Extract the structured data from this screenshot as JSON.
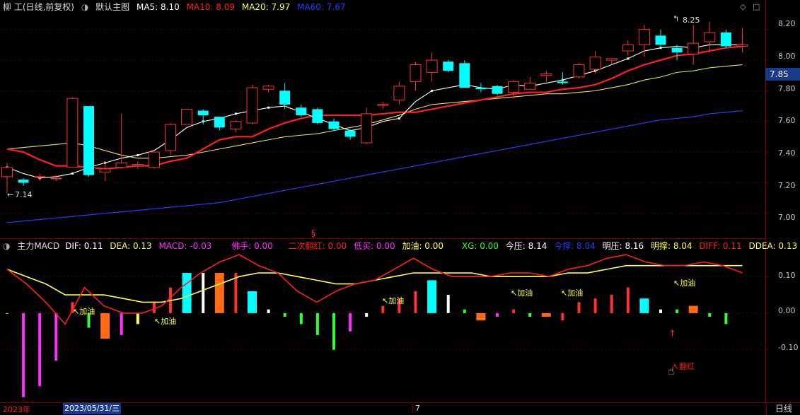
{
  "main": {
    "stock": "柳 工(日线,前复权)",
    "template": "默认主图",
    "ma": [
      {
        "label": "MA5: 8.10",
        "color": "#ffffff"
      },
      {
        "label": "MA10: 8.09",
        "color": "#ff2020"
      },
      {
        "label": "MA20: 7.97",
        "color": "#ffff50"
      },
      {
        "label": "MA60: 7.67",
        "color": "#2a3cff"
      }
    ],
    "y_ticks": [
      "8.20",
      "8.00",
      "7.80",
      "7.60",
      "7.40",
      "7.20",
      "7.00"
    ],
    "current_price": "7.85",
    "low_label": "7.14",
    "high_label": "8.25",
    "marker": "§"
  },
  "sub": {
    "indicator": "主力MACD",
    "values": [
      {
        "label": "DIF: 0.11",
        "color": "#ffffff"
      },
      {
        "label": "DEA: 0.13",
        "color": "#ffff50"
      },
      {
        "label": "MACD: -0.03",
        "color": "#ff30ff"
      },
      {
        "label": "佛手: 0.00",
        "color": "#ff30ff"
      },
      {
        "label": "二次翻红: 0.00",
        "color": "#ff2020"
      },
      {
        "label": "低买: 0.00",
        "color": "#ff30ff"
      },
      {
        "label": "加油: 0.00",
        "color": "#ffff50"
      },
      {
        "label": "XG: 0.00",
        "color": "#30ff30"
      },
      {
        "label": "今压: 8.14",
        "color": "#ffffff"
      },
      {
        "label": "今撑: 8.04",
        "color": "#2a3cff"
      },
      {
        "label": "明压: 8.16",
        "color": "#ffffff"
      },
      {
        "label": "明撑: 8.04",
        "color": "#ffff50"
      },
      {
        "label": "DIFF: 0.11",
        "color": "#ff2020"
      },
      {
        "label": "DDEA: 0.13",
        "color": "#ffff50"
      }
    ],
    "y_ticks": [
      "0.10",
      "0.00",
      "-0.10"
    ],
    "jiayou": "加油",
    "fanhong": "翻红"
  },
  "footer": {
    "year": "2023年",
    "date": "2023/05/31/三",
    "month": "7",
    "period": "日线"
  },
  "colors": {
    "up": "#ff3232",
    "down": "#00ffff",
    "bg": "#000000",
    "grid": "#7a0000"
  },
  "chart_data": {
    "type": "candlestick",
    "candles": [
      [
        7.24,
        7.3,
        7.33,
        7.13
      ],
      [
        7.22,
        7.2,
        7.23,
        7.18
      ],
      [
        7.24,
        7.24,
        7.26,
        7.21
      ],
      [
        7.23,
        7.23,
        7.25,
        7.21
      ],
      [
        7.3,
        7.75,
        7.76,
        7.3
      ],
      [
        7.7,
        7.25,
        7.7,
        7.24
      ],
      [
        7.27,
        7.29,
        7.34,
        7.21
      ],
      [
        7.3,
        7.33,
        7.65,
        7.29
      ],
      [
        7.31,
        7.32,
        7.34,
        7.29
      ],
      [
        7.3,
        7.4,
        7.41,
        7.29
      ],
      [
        7.41,
        7.58,
        7.59,
        7.38
      ],
      [
        7.58,
        7.68,
        7.68,
        7.58
      ],
      [
        7.67,
        7.64,
        7.68,
        7.58
      ],
      [
        7.63,
        7.56,
        7.63,
        7.54
      ],
      [
        7.55,
        7.6,
        7.61,
        7.53
      ],
      [
        7.59,
        7.82,
        7.84,
        7.58
      ],
      [
        7.81,
        7.83,
        7.84,
        7.79
      ],
      [
        7.8,
        7.71,
        7.85,
        7.68
      ],
      [
        7.69,
        7.64,
        7.71,
        7.63
      ],
      [
        7.68,
        7.59,
        7.69,
        7.58
      ],
      [
        7.6,
        7.55,
        7.62,
        7.54
      ],
      [
        7.54,
        7.5,
        7.55,
        7.48
      ],
      [
        7.46,
        7.65,
        7.69,
        7.45
      ],
      [
        7.71,
        7.71,
        7.73,
        7.68
      ],
      [
        7.74,
        7.83,
        7.86,
        7.71
      ],
      [
        7.86,
        7.97,
        7.99,
        7.8
      ],
      [
        7.92,
        8.0,
        8.05,
        7.86
      ],
      [
        7.99,
        7.93,
        8.0,
        7.92
      ],
      [
        7.98,
        7.82,
        8.0,
        7.82
      ],
      [
        7.82,
        7.81,
        7.85,
        7.79
      ],
      [
        7.83,
        7.78,
        7.84,
        7.77
      ],
      [
        7.79,
        7.86,
        7.87,
        7.75
      ],
      [
        7.81,
        7.85,
        7.89,
        7.81
      ],
      [
        7.9,
        7.91,
        7.93,
        7.86
      ],
      [
        7.86,
        7.85,
        7.92,
        7.84
      ],
      [
        7.89,
        7.97,
        7.98,
        7.88
      ],
      [
        7.94,
        8.02,
        8.06,
        7.91
      ],
      [
        8.0,
        8.01,
        8.01,
        7.97
      ],
      [
        8.06,
        8.1,
        8.13,
        8.03
      ],
      [
        8.1,
        8.2,
        8.23,
        8.02
      ],
      [
        8.16,
        8.1,
        8.2,
        8.08
      ],
      [
        8.08,
        8.05,
        8.1,
        8.0
      ],
      [
        8.04,
        8.11,
        8.23,
        7.97
      ],
      [
        8.12,
        8.18,
        8.25,
        8.05
      ],
      [
        8.18,
        8.09,
        8.2,
        8.08
      ],
      [
        8.09,
        8.1,
        8.21,
        8.05
      ]
    ],
    "ma5": [
      7.3,
      7.26,
      7.23,
      7.24,
      7.26,
      7.3,
      7.33,
      7.36,
      7.38,
      7.41,
      7.48,
      7.56,
      7.6,
      7.62,
      7.65,
      7.67,
      7.69,
      7.7,
      7.66,
      7.62,
      7.58,
      7.54,
      7.56,
      7.6,
      7.62,
      7.73,
      7.8,
      7.82,
      7.84,
      7.82,
      7.81,
      7.84,
      7.83,
      7.85,
      7.87,
      7.9,
      7.93,
      7.97,
      8.01,
      8.06,
      8.08,
      8.09,
      8.08,
      8.1,
      8.1,
      8.1
    ],
    "ma10": [
      7.42,
      7.4,
      7.35,
      7.31,
      7.31,
      7.3,
      7.29,
      7.3,
      7.31,
      7.31,
      7.34,
      7.36,
      7.42,
      7.48,
      7.5,
      7.5,
      7.55,
      7.59,
      7.62,
      7.64,
      7.64,
      7.64,
      7.64,
      7.65,
      7.66,
      7.66,
      7.68,
      7.7,
      7.72,
      7.74,
      7.76,
      7.78,
      7.79,
      7.79,
      7.81,
      7.82,
      7.84,
      7.88,
      7.93,
      7.97,
      8.0,
      8.03,
      8.04,
      8.06,
      8.08,
      8.09
    ],
    "ma20": [
      7.42,
      7.43,
      7.44,
      7.45,
      7.46,
      7.44,
      7.41,
      7.38,
      7.36,
      7.36,
      7.37,
      7.38,
      7.4,
      7.42,
      7.44,
      7.46,
      7.48,
      7.5,
      7.51,
      7.52,
      7.54,
      7.56,
      7.58,
      7.61,
      7.64,
      7.68,
      7.71,
      7.72,
      7.73,
      7.74,
      7.75,
      7.76,
      7.77,
      7.78,
      7.78,
      7.79,
      7.8,
      7.82,
      7.84,
      7.87,
      7.89,
      7.92,
      7.93,
      7.95,
      7.96,
      7.97
    ],
    "ma60": [
      6.94,
      6.95,
      6.96,
      6.97,
      6.98,
      6.99,
      7.0,
      7.01,
      7.02,
      7.03,
      7.04,
      7.05,
      7.06,
      7.07,
      7.09,
      7.11,
      7.13,
      7.15,
      7.17,
      7.19,
      7.21,
      7.23,
      7.25,
      7.27,
      7.29,
      7.31,
      7.33,
      7.35,
      7.37,
      7.39,
      7.41,
      7.43,
      7.45,
      7.47,
      7.49,
      7.51,
      7.53,
      7.55,
      7.57,
      7.59,
      7.61,
      7.62,
      7.63,
      7.65,
      7.66,
      7.67
    ],
    "macd": [
      -0.0,
      -0.23,
      -0.2,
      -0.13,
      0.03,
      -0.04,
      -0.07,
      -0.06,
      -0.03,
      0.03,
      0.07,
      0.11,
      0.11,
      0.11,
      0.11,
      0.06,
      0.01,
      -0.01,
      -0.03,
      -0.06,
      -0.1,
      -0.05,
      -0.01,
      0.02,
      0.04,
      0.06,
      0.09,
      0.05,
      0.01,
      -0.02,
      -0.01,
      0.01,
      -0.01,
      -0.01,
      -0.02,
      0.03,
      0.04,
      0.05,
      0.07,
      0.04,
      0.01,
      0.01,
      0.02,
      -0.01,
      -0.03
    ],
    "macd_colors": [
      "#30ff30",
      "#ff30ff",
      "#ff30ff",
      "#ff30ff",
      "#ff3232",
      "#30ff30",
      "#ff6a14",
      "#ff30ff",
      "#ffff50",
      "#ff3232",
      "#ff3232",
      "#00ffff",
      "#ffffff",
      "#ff6a14",
      "#ff3232",
      "#00ffff",
      "#ffffff",
      "#30ff30",
      "#30ff30",
      "#30ff30",
      "#30ff30",
      "#ff30ff",
      "#ffffff",
      "#ff3232",
      "#ff3232",
      "#ff3232",
      "#00ffff",
      "#ffffff",
      "#30ff30",
      "#ff6a14",
      "#ff30ff",
      "#ff3232",
      "#30ff30",
      "#ff6a14",
      "#ff3232",
      "#ff3232",
      "#ff3232",
      "#ff3232",
      "#ff3232",
      "#00ffff",
      "#ffffff",
      "#30ff30",
      "#ff6a14",
      "#30ff30",
      "#30ff30"
    ],
    "dif": [
      0.12,
      0.08,
      0.03,
      -0.03,
      0.07,
      0.02,
      0.0,
      -0.0,
      0.02,
      0.07,
      0.11,
      0.14,
      0.16,
      0.13,
      0.11,
      0.06,
      0.03,
      0.06,
      0.08,
      0.09,
      0.12,
      0.15,
      0.12,
      0.1,
      0.1,
      0.1,
      0.11,
      0.11,
      0.1,
      0.12,
      0.13,
      0.15,
      0.16,
      0.14,
      0.13,
      0.13,
      0.14,
      0.13,
      0.11
    ],
    "dea": [
      0.12,
      0.1,
      0.08,
      0.05,
      0.05,
      0.05,
      0.04,
      0.03,
      0.03,
      0.04,
      0.06,
      0.08,
      0.1,
      0.11,
      0.11,
      0.1,
      0.09,
      0.08,
      0.08,
      0.09,
      0.1,
      0.11,
      0.11,
      0.11,
      0.11,
      0.1,
      0.1,
      0.1,
      0.1,
      0.11,
      0.11,
      0.12,
      0.13,
      0.13,
      0.13,
      0.13,
      0.13,
      0.13,
      0.13
    ],
    "ylim_main": [
      6.87,
      8.3
    ],
    "ylim_sub": [
      -0.24,
      0.17
    ]
  }
}
